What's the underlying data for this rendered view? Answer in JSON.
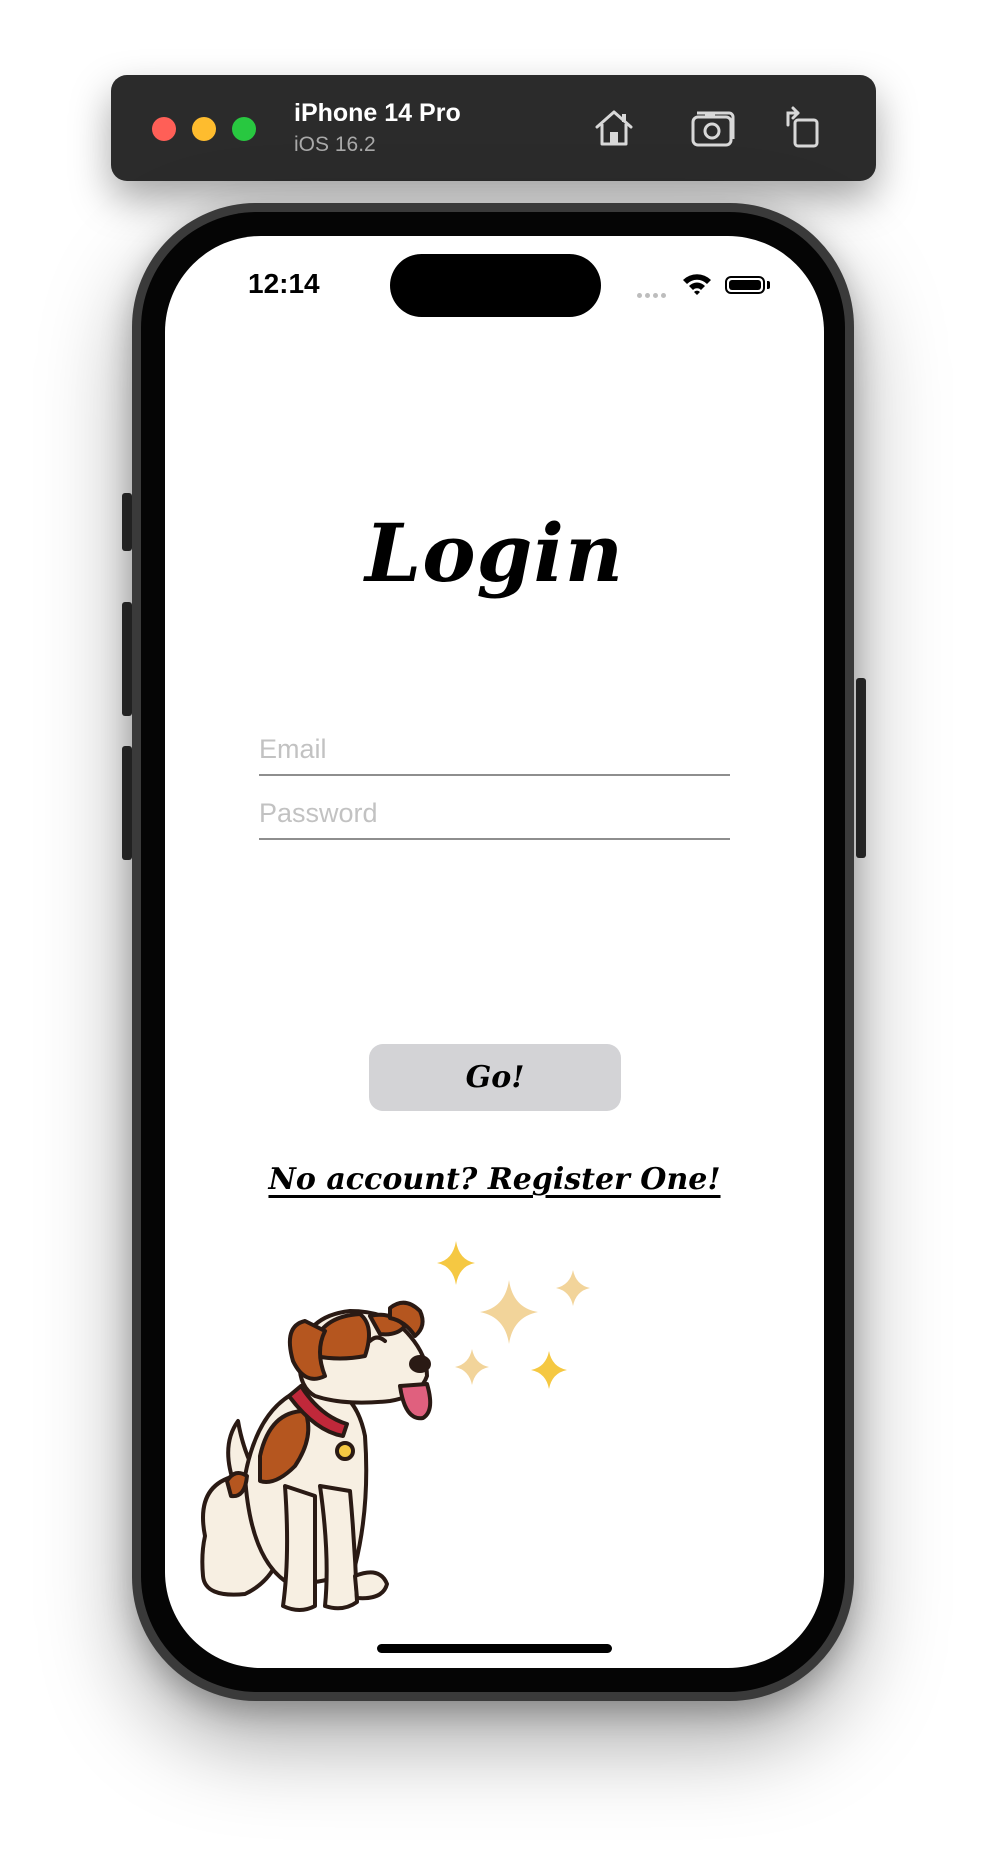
{
  "simulator": {
    "device_name": "iPhone 14 Pro",
    "os_version": "iOS 16.2",
    "icons": [
      "home-icon",
      "screenshot-icon",
      "rotate-icon"
    ]
  },
  "status_bar": {
    "time": "12:14",
    "icons": [
      "cellular-signal-icon",
      "wifi-icon",
      "battery-icon"
    ]
  },
  "login": {
    "title": "Login",
    "email_placeholder": "Email",
    "email_value": "",
    "password_placeholder": "Password",
    "password_value": "",
    "go_label": "Go!",
    "register_label": "No account? Register One!"
  },
  "colors": {
    "toolbar_bg": "#2b2b2b",
    "button_bg": "#d3d3d6",
    "sparkle_gold": "#f5c842",
    "sparkle_pale": "#f2d49a",
    "dog_brown": "#b5561f",
    "dog_collar": "#c0283a"
  }
}
